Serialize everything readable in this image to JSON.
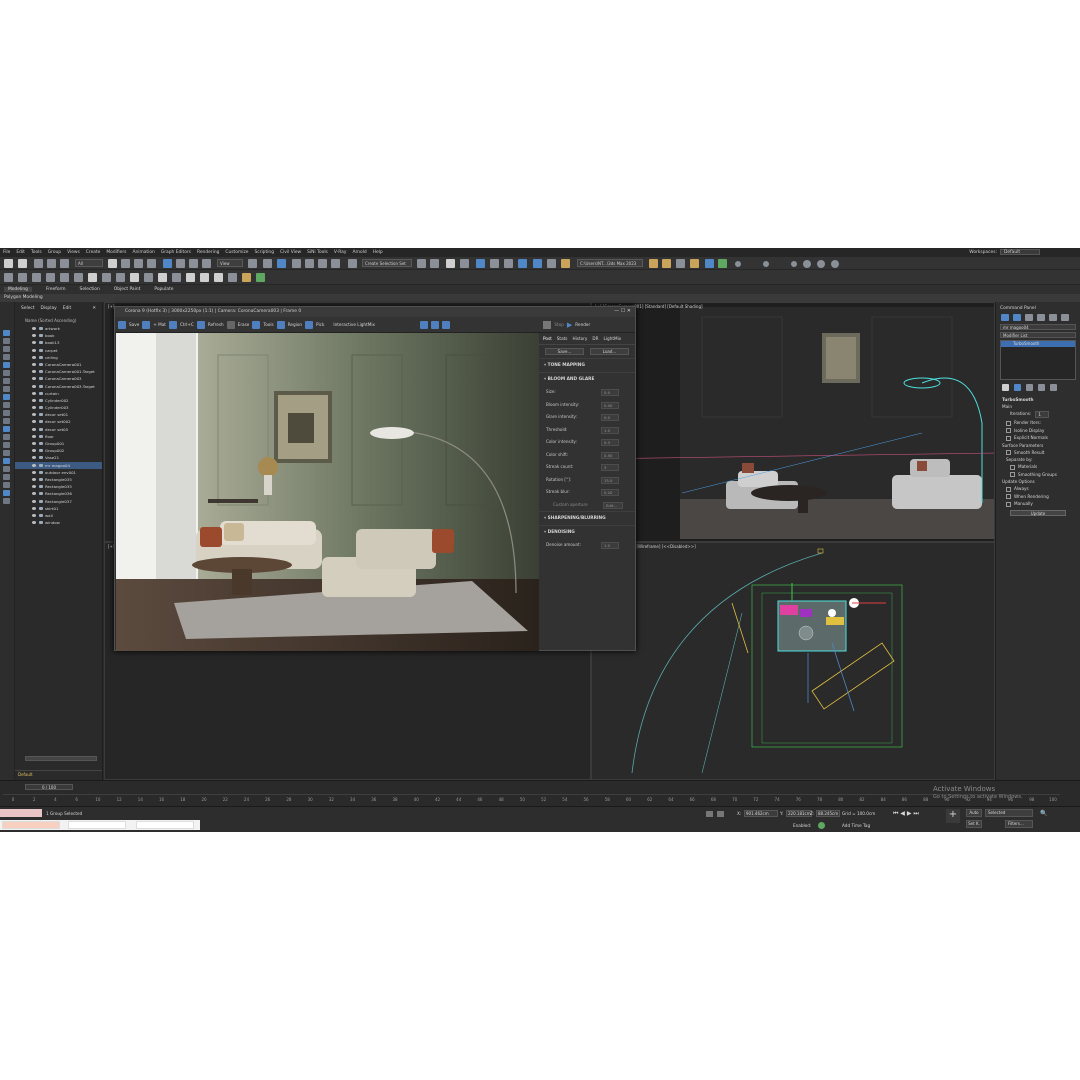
{
  "menu": [
    "File",
    "Edit",
    "Tools",
    "Group",
    "Views",
    "Create",
    "Modifiers",
    "Animation",
    "Graph Editors",
    "Rendering",
    "Customize",
    "Scripting",
    "Civil View",
    "SiNi Tools",
    "V-Ray",
    "Arnold",
    "Help"
  ],
  "workspace": {
    "label": "Workspaces:",
    "value": "Default"
  },
  "toolbar": {
    "filter_value": "All",
    "view_value": "View",
    "selection_set_placeholder": "Create Selection Set",
    "project_path": "C:\\Users\\NT...\\3ds Max 2023"
  },
  "ribbon": {
    "tabs": [
      "Modeling",
      "Freeform",
      "Selection",
      "Object Paint",
      "Populate"
    ],
    "sub": "Polygon Modeling"
  },
  "scene_explorer": {
    "tabs": [
      "Select",
      "Display",
      "Edit"
    ],
    "header": "Name (Sorted Ascending)",
    "items": [
      "artwork",
      "book",
      "book13",
      "carpet",
      "ceiling",
      "CoronaCamera001",
      "CoronaCamera001.Target",
      "CoronaCamera003",
      "CoronaCamera003.Target",
      "curtain",
      "Cylinder002",
      "Cylinder003",
      "decor set01",
      "decor set002",
      "decor set05",
      "floor",
      "Group001",
      "Group002",
      "Vase21",
      "mr magoo04",
      "outdoor env001",
      "Rectangle035",
      "Rectangle035",
      "Rectangle036",
      "Rectangle037",
      "skirt01",
      "wall",
      "window"
    ],
    "selected_index": 19,
    "layer": "Default"
  },
  "viewports": {
    "top_right_label": "[+] [CoronaCamera001] [Standard] [Default Shading]",
    "bottom_right_label": "[+] [Top] [Standard] [Wireframe] [<<Disabled>>]",
    "left_top_label": "[+]",
    "left_bottom_label": "[+]"
  },
  "render_window": {
    "title": "Corona 9 (Hotfix 3) | 3000x2250px (1:1) | Camera: CoronaCamera003 | Frame 0",
    "toolbar": [
      "Save",
      "+ Mat",
      "Ctrl+C",
      "Refresh",
      "Erase",
      "Tools",
      "Region",
      "Pick"
    ],
    "mode": "Interactive LightMix",
    "stop_label": "Stop",
    "render_label": "Render",
    "tabs": [
      "Post",
      "Stats",
      "History",
      "DR",
      "LightMix"
    ],
    "save_button": "Save...",
    "load_button": "Load...",
    "sections": {
      "tone_mapping": "TONE MAPPING",
      "bloom_glare": "BLOOM AND GLARE",
      "sharpening": "SHARPENING/BLURRING",
      "denoising": "DENOISING"
    },
    "bloom_params": [
      {
        "label": "Size:",
        "value": "0.0"
      },
      {
        "label": "Bloom intensity:",
        "value": "0.00"
      },
      {
        "label": "Glare intensity:",
        "value": "0.0"
      },
      {
        "label": "Threshold:",
        "value": "1.0"
      },
      {
        "label": "Color intensity:",
        "value": "0.3"
      },
      {
        "label": "Color shift:",
        "value": "0.50"
      },
      {
        "label": "Streak count:",
        "value": "3"
      },
      {
        "label": "Rotation [°]:",
        "value": "15.0"
      },
      {
        "label": "Streak blur:",
        "value": "0.20"
      }
    ],
    "custom_aperture": "Custom aperture",
    "edit_button": "Edit...",
    "denoise_label": "Denoise amount:",
    "denoise_value": "1.0"
  },
  "command_panel": {
    "title": "Command Panel",
    "object_name": "mr magoo04",
    "modifier_list": "Modifier List",
    "stack_item": "TurboSmooth",
    "rollout": "TurboSmooth",
    "main": "Main",
    "iterations_label": "Iterations:",
    "iterations_value": "1",
    "render_iters": "Render Iters:",
    "isoline": "Isoline Display",
    "explicit": "Explicit Normals",
    "surface": "Surface Parameters",
    "smooth_result": "Smooth Result",
    "separate": "Separate by:",
    "materials": "Materials",
    "smoothing_groups": "Smoothing Groups",
    "update_options": "Update Options",
    "always": "Always",
    "when_rendering": "When Rendering",
    "manually": "Manually",
    "update_button": "Update"
  },
  "timeline": {
    "position": "0 / 100",
    "ticks": [
      "0",
      "2",
      "4",
      "6",
      "10",
      "12",
      "14",
      "16",
      "18",
      "20",
      "22",
      "24",
      "26",
      "28",
      "30",
      "32",
      "34",
      "36",
      "38",
      "40",
      "42",
      "44",
      "46",
      "48",
      "50",
      "52",
      "54",
      "56",
      "58",
      "60",
      "62",
      "64",
      "66",
      "68",
      "70",
      "72",
      "74",
      "76",
      "78",
      "80",
      "82",
      "84",
      "86",
      "88",
      "90",
      "92",
      "94",
      "96",
      "98",
      "100"
    ]
  },
  "status": {
    "selected": "1 Group Selected",
    "x_label": "X:",
    "x_value": "901.462cm",
    "y_label": "Y:",
    "y_value": "220.181cm",
    "z_label": "Z:",
    "z_value": "88.245cm",
    "grid": "Grid = 100.0cm",
    "enabled": "Enabled:",
    "add_time_tag": "Add Time Tag",
    "auto": "Auto",
    "set_k": "Set K.",
    "selected_dd": "Selected",
    "filters": "Filters..."
  },
  "watermark": {
    "line1": "Activate Windows",
    "line2": "Go to Settings to activate Windows."
  },
  "colors": {
    "accent": "#4f87c7",
    "selection": "#3d5a82",
    "bg": "#2b2b2b"
  }
}
